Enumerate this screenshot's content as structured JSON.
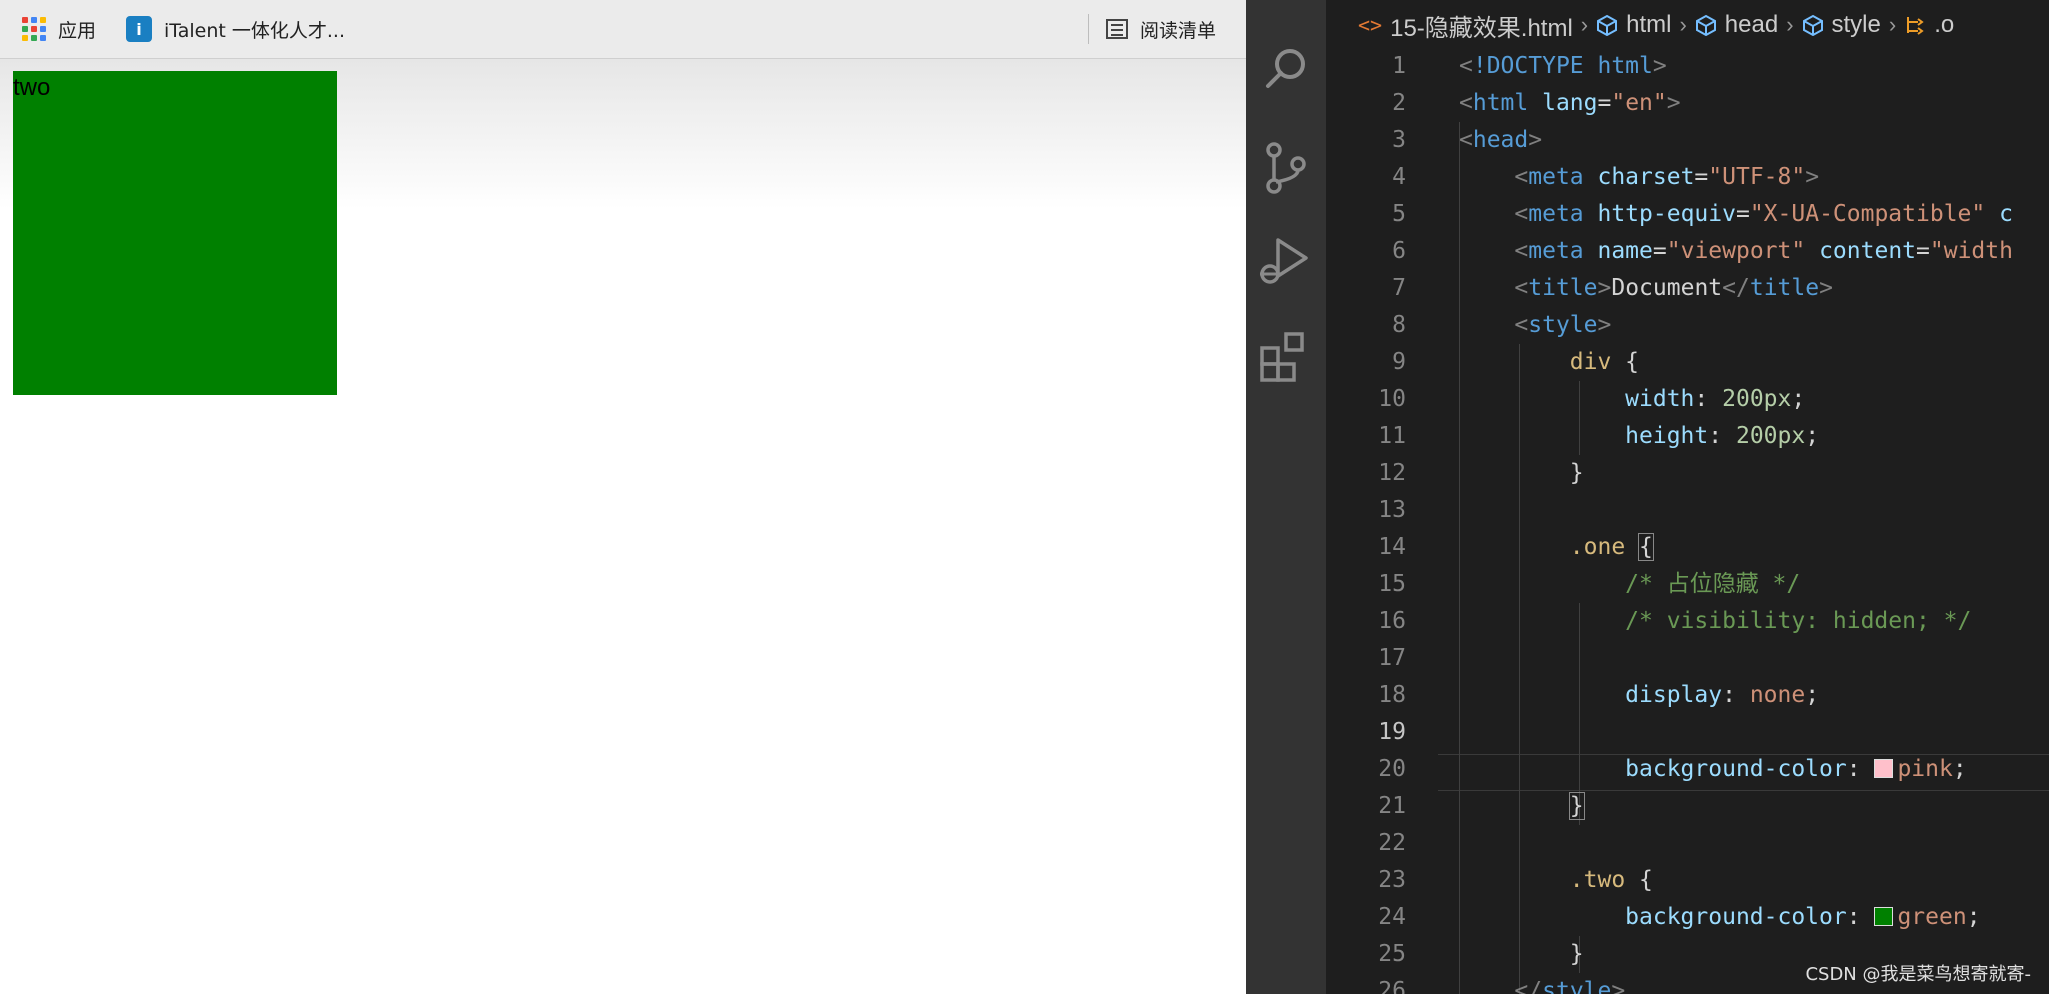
{
  "browser": {
    "bookmarks": {
      "apps_label": "应用",
      "italent_label": "iTalent 一体化人才...",
      "italent_logo_text": "i",
      "reading_list_label": "阅读清单"
    },
    "page": {
      "box_text": "two",
      "box_color": "#008000"
    }
  },
  "editor": {
    "breadcrumb": [
      "15-隐藏效果.html",
      "html",
      "head",
      "style",
      ".o"
    ],
    "current_line": 19,
    "lines": [
      {
        "n": "1",
        "t": [
          [
            "#808080",
            "<"
          ],
          [
            "#569cd6",
            "!DOCTYPE html"
          ],
          [
            "#808080",
            ">"
          ]
        ]
      },
      {
        "n": "2",
        "t": [
          [
            "#808080",
            "<"
          ],
          [
            "#569cd6",
            "html"
          ],
          [
            "#9cdcfe",
            " lang"
          ],
          [
            "#d4d4d4",
            "="
          ],
          [
            "#ce9178",
            "\"en\""
          ],
          [
            "#808080",
            ">"
          ]
        ]
      },
      {
        "n": "3",
        "t": [
          [
            "#808080",
            "<"
          ],
          [
            "#569cd6",
            "head"
          ],
          [
            "#808080",
            ">"
          ]
        ]
      },
      {
        "n": "4",
        "t": [
          [
            "#d4d4d4",
            "    "
          ],
          [
            "#808080",
            "<"
          ],
          [
            "#569cd6",
            "meta"
          ],
          [
            "#9cdcfe",
            " charset"
          ],
          [
            "#d4d4d4",
            "="
          ],
          [
            "#ce9178",
            "\"UTF-8\""
          ],
          [
            "#808080",
            ">"
          ]
        ]
      },
      {
        "n": "5",
        "t": [
          [
            "#d4d4d4",
            "    "
          ],
          [
            "#808080",
            "<"
          ],
          [
            "#569cd6",
            "meta"
          ],
          [
            "#9cdcfe",
            " http-equiv"
          ],
          [
            "#d4d4d4",
            "="
          ],
          [
            "#ce9178",
            "\"X-UA-Compatible\""
          ],
          [
            "#9cdcfe",
            " c"
          ]
        ]
      },
      {
        "n": "6",
        "t": [
          [
            "#d4d4d4",
            "    "
          ],
          [
            "#808080",
            "<"
          ],
          [
            "#569cd6",
            "meta"
          ],
          [
            "#9cdcfe",
            " name"
          ],
          [
            "#d4d4d4",
            "="
          ],
          [
            "#ce9178",
            "\"viewport\""
          ],
          [
            "#9cdcfe",
            " content"
          ],
          [
            "#d4d4d4",
            "="
          ],
          [
            "#ce9178",
            "\"width"
          ]
        ]
      },
      {
        "n": "7",
        "t": [
          [
            "#d4d4d4",
            "    "
          ],
          [
            "#808080",
            "<"
          ],
          [
            "#569cd6",
            "title"
          ],
          [
            "#808080",
            ">"
          ],
          [
            "#d4d4d4",
            "Document"
          ],
          [
            "#808080",
            "</"
          ],
          [
            "#569cd6",
            "title"
          ],
          [
            "#808080",
            ">"
          ]
        ]
      },
      {
        "n": "8",
        "t": [
          [
            "#d4d4d4",
            "    "
          ],
          [
            "#808080",
            "<"
          ],
          [
            "#569cd6",
            "style"
          ],
          [
            "#808080",
            ">"
          ]
        ]
      },
      {
        "n": "9",
        "t": [
          [
            "#d4d4d4",
            "        "
          ],
          [
            "#d7ba7d",
            "div"
          ],
          [
            "#d4d4d4",
            " {"
          ]
        ]
      },
      {
        "n": "10",
        "t": [
          [
            "#d4d4d4",
            "            "
          ],
          [
            "#9cdcfe",
            "width"
          ],
          [
            "#d4d4d4",
            ": "
          ],
          [
            "#b5cea8",
            "200px"
          ],
          [
            "#d4d4d4",
            ";"
          ]
        ]
      },
      {
        "n": "11",
        "t": [
          [
            "#d4d4d4",
            "            "
          ],
          [
            "#9cdcfe",
            "height"
          ],
          [
            "#d4d4d4",
            ": "
          ],
          [
            "#b5cea8",
            "200px"
          ],
          [
            "#d4d4d4",
            ";"
          ]
        ]
      },
      {
        "n": "12",
        "t": [
          [
            "#d4d4d4",
            "        }"
          ]
        ]
      },
      {
        "n": "13",
        "t": []
      },
      {
        "n": "14",
        "t": [
          [
            "#d4d4d4",
            "        "
          ],
          [
            "#d7ba7d",
            ".one"
          ],
          [
            "#d4d4d4",
            " "
          ],
          [
            "#d4d4d4",
            "{",
            "box"
          ]
        ]
      },
      {
        "n": "15",
        "t": [
          [
            "#d4d4d4",
            "            "
          ],
          [
            "#6a9955",
            "/* 占位隐藏 */"
          ]
        ]
      },
      {
        "n": "16",
        "t": [
          [
            "#d4d4d4",
            "            "
          ],
          [
            "#6a9955",
            "/* visibility: hidden; */"
          ]
        ]
      },
      {
        "n": "17",
        "t": []
      },
      {
        "n": "18",
        "t": [
          [
            "#d4d4d4",
            "            "
          ],
          [
            "#9cdcfe",
            "display"
          ],
          [
            "#d4d4d4",
            ": "
          ],
          [
            "#ce9178",
            "none"
          ],
          [
            "#d4d4d4",
            ";"
          ]
        ]
      },
      {
        "n": "19",
        "t": []
      },
      {
        "n": "20",
        "t": [
          [
            "#d4d4d4",
            "            "
          ],
          [
            "#9cdcfe",
            "background-color"
          ],
          [
            "#d4d4d4",
            ": "
          ],
          [
            "swatch",
            "#ffc0cb"
          ],
          [
            "#ce9178",
            "pink"
          ],
          [
            "#d4d4d4",
            ";"
          ]
        ]
      },
      {
        "n": "21",
        "t": [
          [
            "#d4d4d4",
            "        "
          ],
          [
            "#d4d4d4",
            "}",
            "box"
          ]
        ]
      },
      {
        "n": "22",
        "t": []
      },
      {
        "n": "23",
        "t": [
          [
            "#d4d4d4",
            "        "
          ],
          [
            "#d7ba7d",
            ".two"
          ],
          [
            "#d4d4d4",
            " {"
          ]
        ]
      },
      {
        "n": "24",
        "t": [
          [
            "#d4d4d4",
            "            "
          ],
          [
            "#9cdcfe",
            "background-color"
          ],
          [
            "#d4d4d4",
            ": "
          ],
          [
            "swatch",
            "#008000"
          ],
          [
            "#ce9178",
            "green"
          ],
          [
            "#d4d4d4",
            ";"
          ]
        ]
      },
      {
        "n": "25",
        "t": [
          [
            "#d4d4d4",
            "        }"
          ]
        ]
      },
      {
        "n": "26",
        "t": [
          [
            "#d4d4d4",
            "    "
          ],
          [
            "#808080",
            "</"
          ],
          [
            "#569cd6",
            "style"
          ],
          [
            "#808080",
            ">"
          ]
        ]
      }
    ]
  },
  "watermark": "CSDN @我是菜鸟想寄就寄-"
}
